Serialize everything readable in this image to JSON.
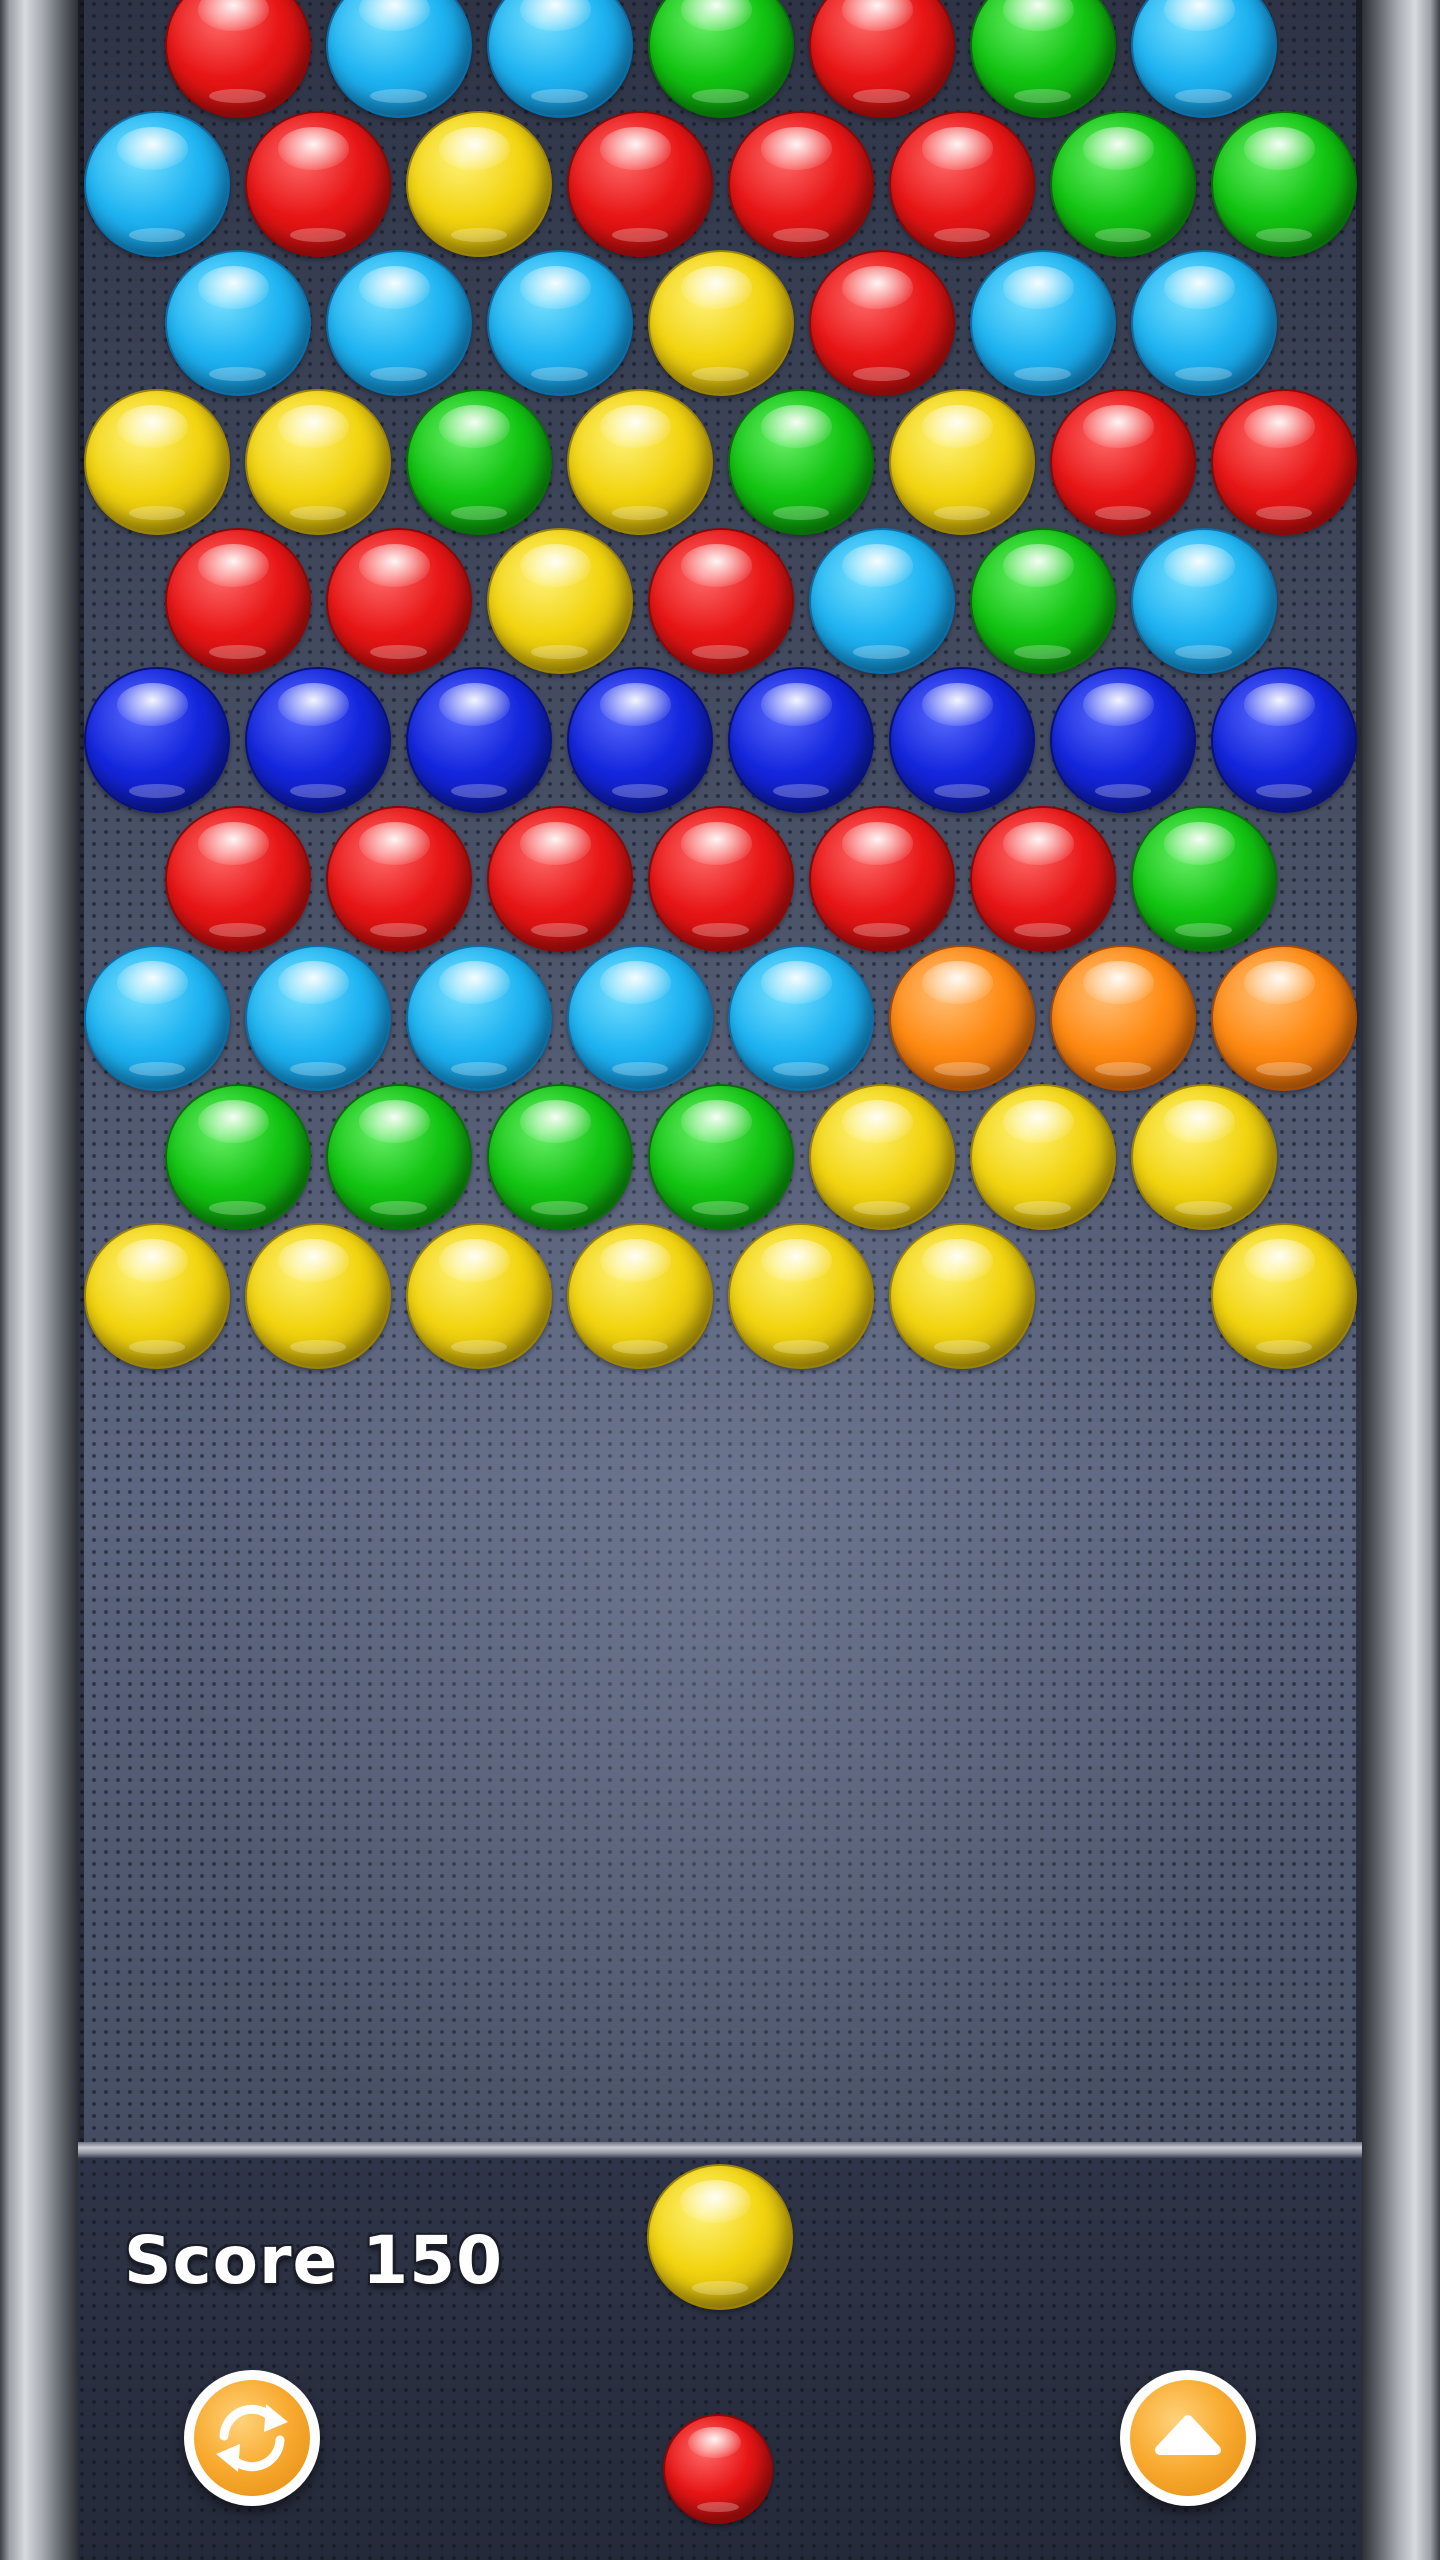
{
  "score": {
    "label": "Score 150"
  },
  "grid": {
    "rows": [
      [
        "red",
        "cyan",
        "cyan",
        "green",
        "red",
        "green",
        "cyan"
      ],
      [
        "cyan",
        "red",
        "yellow",
        "red",
        "red",
        "red",
        "green",
        "green"
      ],
      [
        "cyan",
        "cyan",
        "cyan",
        "yellow",
        "red",
        "cyan",
        "cyan"
      ],
      [
        "yellow",
        "yellow",
        "green",
        "yellow",
        "green",
        "yellow",
        "red",
        "red"
      ],
      [
        "red",
        "red",
        "yellow",
        "red",
        "cyan",
        "green",
        "cyan"
      ],
      [
        "blue",
        "blue",
        "blue",
        "blue",
        "blue",
        "blue",
        "blue",
        "blue"
      ],
      [
        "red",
        "red",
        "red",
        "red",
        "red",
        "red",
        "green"
      ],
      [
        "cyan",
        "cyan",
        "cyan",
        "cyan",
        "cyan",
        "orange",
        "orange",
        "orange"
      ],
      [
        "green",
        "green",
        "green",
        "green",
        "yellow",
        "yellow",
        "yellow"
      ],
      [
        "yellow",
        "yellow",
        "yellow",
        "yellow",
        "yellow",
        "yellow",
        null,
        "yellow"
      ]
    ]
  },
  "shooter": {
    "current_bubble": "yellow",
    "next_bubble": "red"
  },
  "controls": {
    "swap_icon": "swap-arrows-icon",
    "menu_icon": "up-arrow-icon"
  },
  "colors": {
    "red": "#e81515",
    "cyan": "#1fb4f2",
    "green": "#12c412",
    "yellow": "#f2d40f",
    "blue": "#1426dc",
    "orange": "#ff8a12",
    "button": "#f8a92e"
  }
}
